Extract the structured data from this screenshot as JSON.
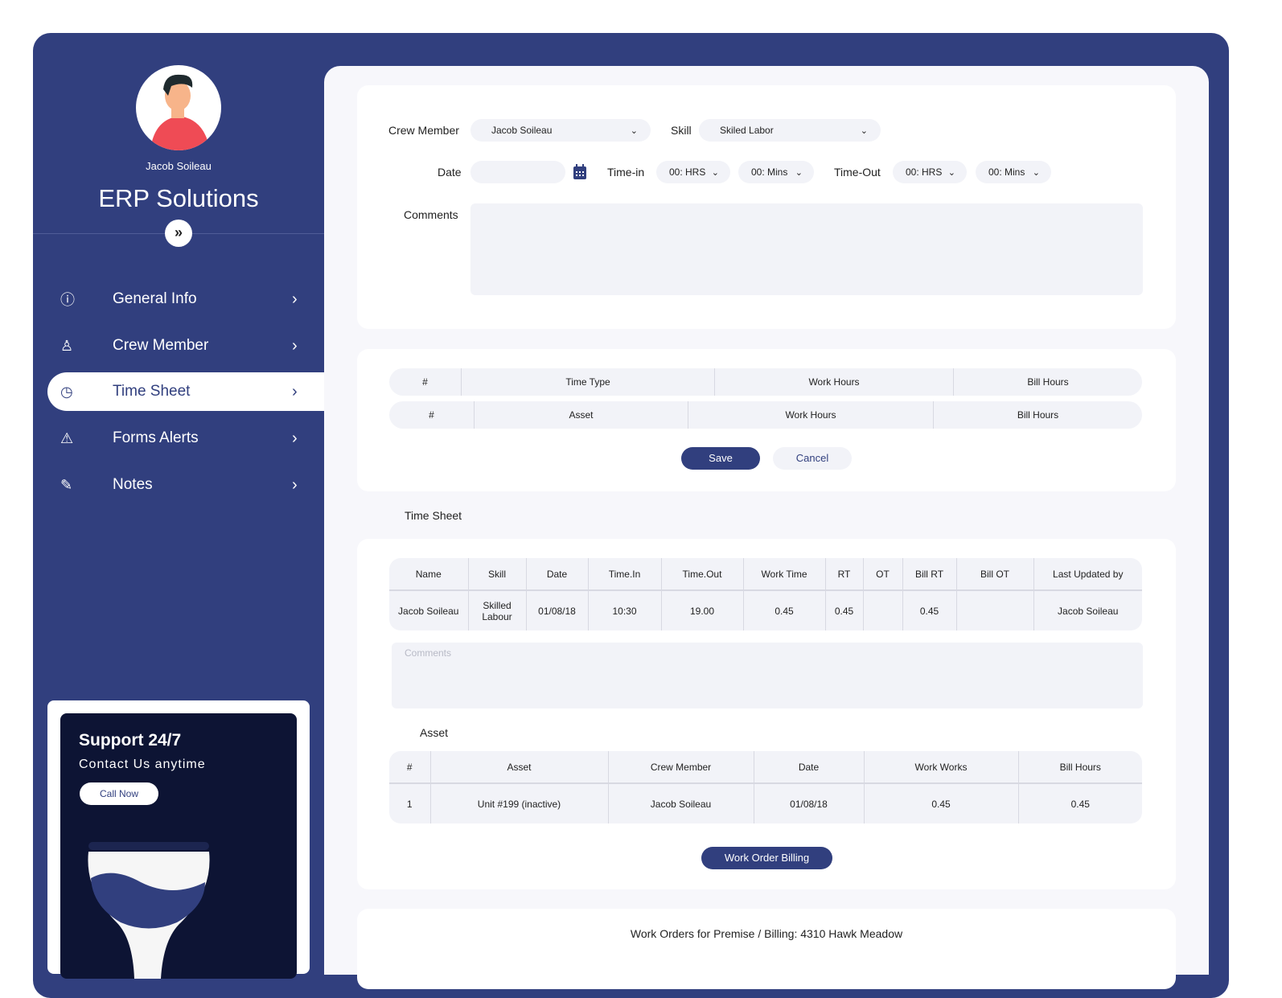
{
  "sidebar": {
    "user_name": "Jacob Soileau",
    "brand": "ERP Solutions",
    "expand_icon": "»",
    "items": [
      {
        "label": "General Info",
        "icon": "ⓘ"
      },
      {
        "label": "Crew Member",
        "icon": "♙"
      },
      {
        "label": "Time Sheet",
        "icon": "◷"
      },
      {
        "label": "Forms Alerts",
        "icon": "⚠"
      },
      {
        "label": "Notes",
        "icon": "✎"
      }
    ],
    "chevron": "›",
    "support": {
      "title": "Support 24/7",
      "subtitle": "Contact Us anytime",
      "button": "Call Now"
    }
  },
  "form": {
    "crew_member_label": "Crew Member",
    "crew_member_value": "Jacob Soileau",
    "skill_label": "Skill",
    "skill_value": "Skiled Labor",
    "date_label": "Date",
    "date_value": "",
    "time_in_label": "Time-in",
    "time_out_label": "Time-Out",
    "hrs": "00: HRS",
    "mins": "00: Mins",
    "comments_label": "Comments",
    "chevron": "⌄"
  },
  "entry": {
    "row1": [
      "#",
      "Time Type",
      "Work Hours",
      "Bill Hours"
    ],
    "row2": [
      "#",
      "Asset",
      "Work Hours",
      "Bill Hours"
    ],
    "save": "Save",
    "cancel": "Cancel"
  },
  "timesheet": {
    "title": "Time Sheet",
    "headers": [
      "Name",
      "Skill",
      "Date",
      "Time.In",
      "Time.Out",
      "Work Time",
      "RT",
      "OT",
      "Bill RT",
      "Bill OT",
      "Last Updated by"
    ],
    "rows": [
      [
        "Jacob Soileau",
        "Skilled Labour",
        "01/08/18",
        "10:30",
        "19.00",
        "0.45",
        "0.45",
        "",
        "0.45",
        "",
        "Jacob Soileau"
      ]
    ],
    "comments_placeholder": "Comments"
  },
  "asset": {
    "title": "Asset",
    "headers": [
      "#",
      "Asset",
      "Crew Member",
      "Date",
      "Work Works",
      "Bill Hours"
    ],
    "rows": [
      [
        "1",
        "Unit #199 (inactive)",
        "Jacob Soileau",
        "01/08/18",
        "0.45",
        "0.45"
      ]
    ],
    "button": "Work Order Billing"
  },
  "footer_title": "Work Orders for Premise / Billing: 4310 Hawk Meadow"
}
